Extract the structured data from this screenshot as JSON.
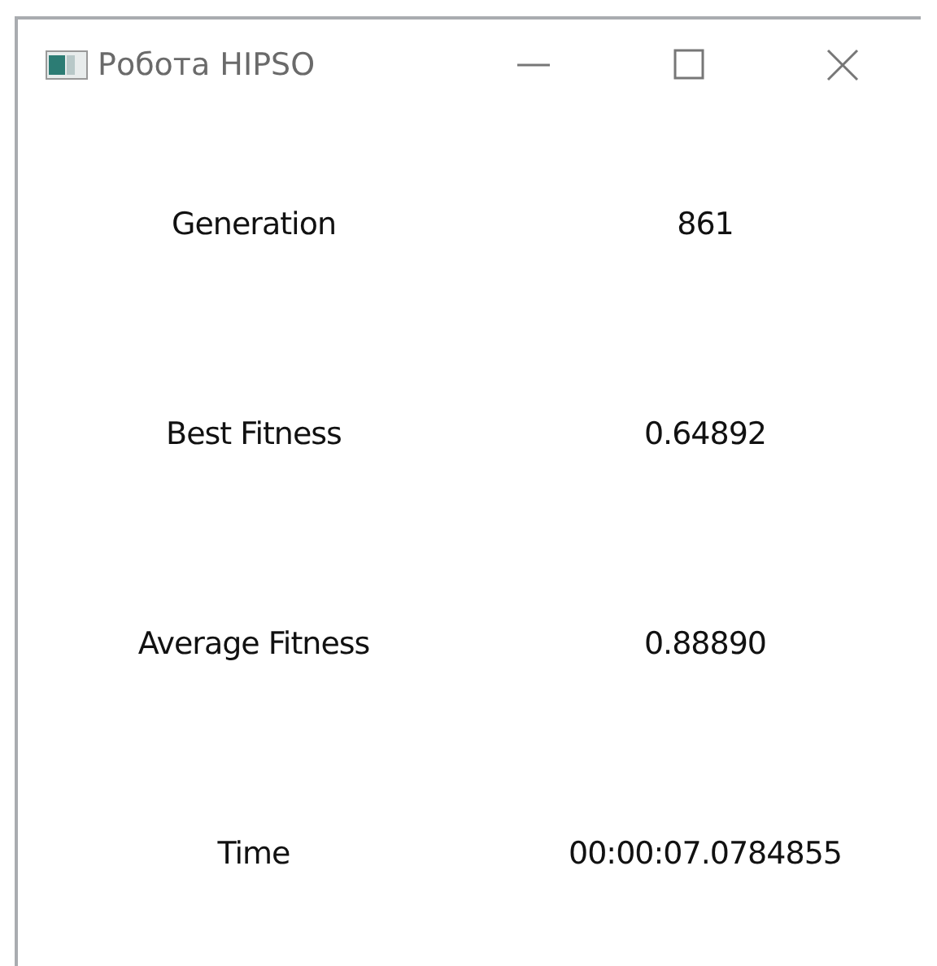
{
  "window": {
    "title": "Робота HIPSO"
  },
  "stats": [
    {
      "label": "Generation",
      "value": "861"
    },
    {
      "label": "Best Fitness",
      "value": "0.64892"
    },
    {
      "label": "Average Fitness",
      "value": "0.88890"
    },
    {
      "label": "Time",
      "value": "00:00:07.0784855"
    }
  ]
}
